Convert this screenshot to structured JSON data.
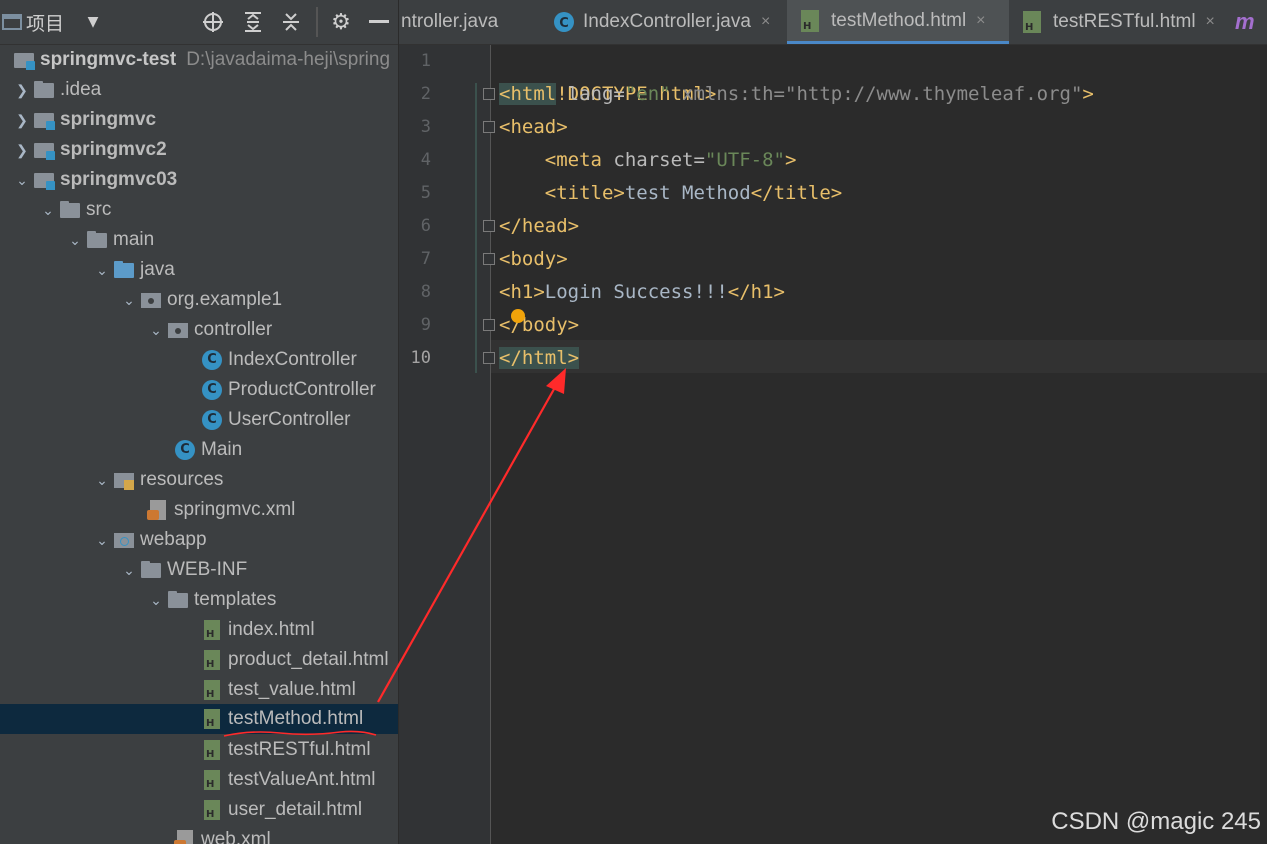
{
  "toolbar": {
    "project_label": "项目"
  },
  "tree": {
    "root_name": "springmvc-test",
    "root_path": "D:\\javadaima-heji\\spring",
    "idea": ".idea",
    "springmvc": "springmvc",
    "springmvc2": "springmvc2",
    "springmvc03": "springmvc03",
    "src": "src",
    "main": "main",
    "java": "java",
    "org_example1": "org.example1",
    "controller": "controller",
    "index_controller": "IndexController",
    "product_controller": "ProductController",
    "user_controller": "UserController",
    "main_class": "Main",
    "resources": "resources",
    "springmvc_xml": "springmvc.xml",
    "webapp": "webapp",
    "web_inf": "WEB-INF",
    "templates": "templates",
    "index_html": "index.html",
    "product_detail_html": "product_detail.html",
    "test_value_html": "test_value.html",
    "test_method_html": "testMethod.html",
    "test_restful_html": "testRESTful.html",
    "test_value_ant_html": "testValueAnt.html",
    "user_detail_html": "user_detail.html",
    "web_xml": "web.xml"
  },
  "tabs": {
    "tab1": "ntroller.java",
    "tab2": "IndexController.java",
    "tab3": "testMethod.html",
    "tab4": "testRESTful.html",
    "close": "×",
    "more": "m"
  },
  "editor": {
    "line_numbers": [
      "1",
      "2",
      "3",
      "4",
      "5",
      "6",
      "7",
      "8",
      "9",
      "10"
    ],
    "l1": "<!DOCTYPE html>",
    "l2_open": "<html",
    "l2_attr1": " lang=",
    "l2_val1": "\"en\"",
    "l2_attr2": " xmlns:th=",
    "l2_val2": "\"http://www.thymeleaf.org\"",
    "l2_close": ">",
    "l3": "<head>",
    "l4_open": "    <meta",
    "l4_attr": " charset=",
    "l4_val": "\"UTF-8\"",
    "l4_close": ">",
    "l5_open": "    <title>",
    "l5_text": "test Method",
    "l5_close": "</title>",
    "l6": "</head>",
    "l7": "<body>",
    "l8_open": "<h1>",
    "l8_text": "Login Success!!!",
    "l8_close": "</h1>",
    "l9": "</body>",
    "l10": "</html>"
  },
  "watermark": "CSDN @magic 245",
  "colors": {
    "annotation_red": "#ff2a2a",
    "accent_blue": "#4a88c7",
    "tag_yellow": "#e8bf6a",
    "string_green": "#6a8759"
  }
}
